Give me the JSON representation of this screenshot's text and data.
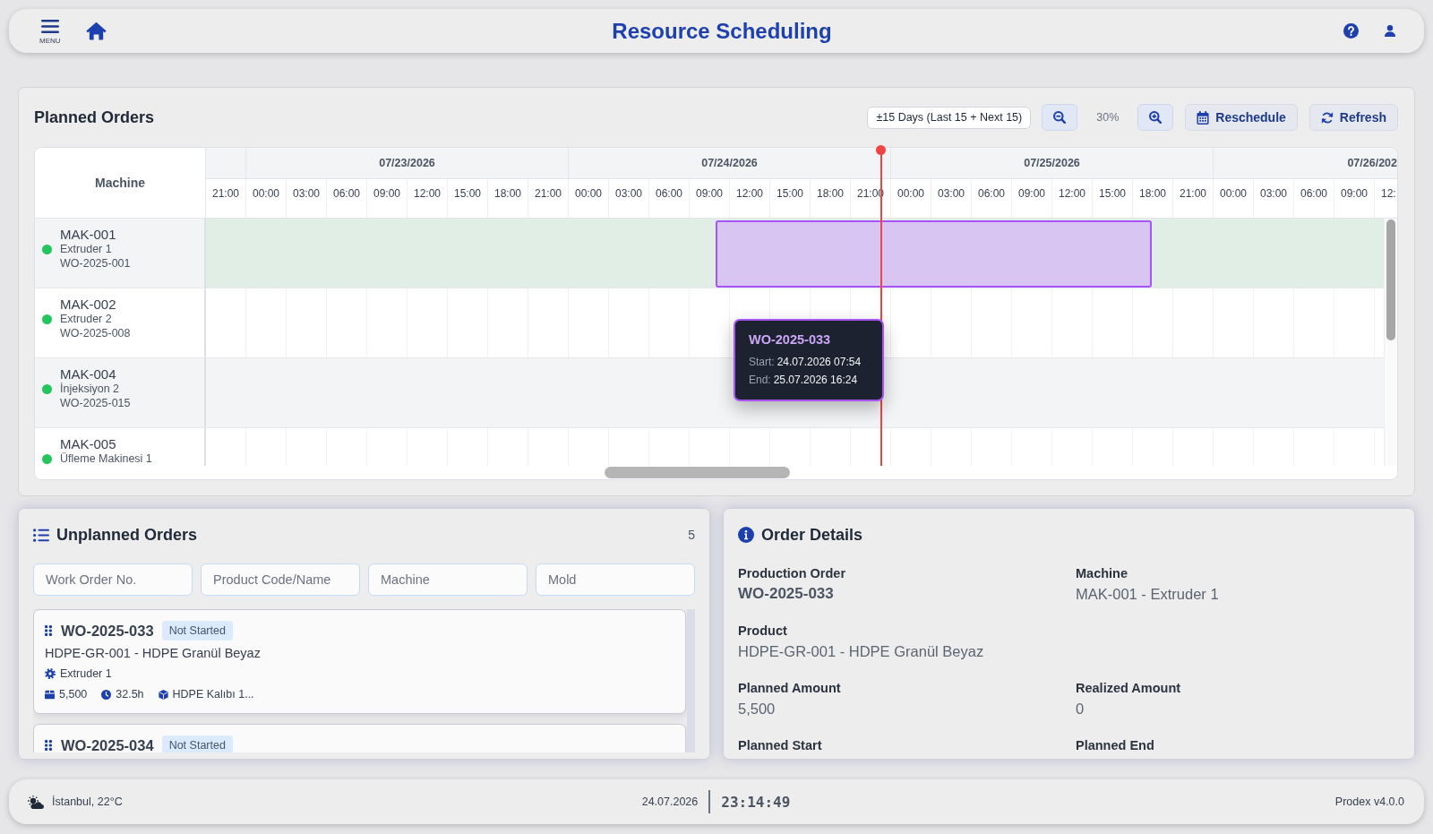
{
  "header": {
    "menu_label": "MENU",
    "title": "Resource Scheduling"
  },
  "planned_orders": {
    "title": "Planned Orders",
    "range_select": {
      "value": "±15 Days (Last 15 + Next 15)"
    },
    "zoom": {
      "reading": "30%"
    },
    "buttons": [
      {
        "label": "Reschedule",
        "kind": "calendar"
      },
      {
        "label": "Refresh",
        "kind": "refresh"
      }
    ],
    "gantt": {
      "machine_heading": "Machine",
      "lead_hours": [
        "21:00"
      ],
      "days": [
        {
          "date": "07/23/2026",
          "hours": [
            "00:00",
            "03:00",
            "06:00",
            "09:00",
            "12:00",
            "15:00",
            "18:00",
            "21:00"
          ]
        },
        {
          "date": "07/24/2026",
          "hours": [
            "00:00",
            "03:00",
            "06:00",
            "09:00",
            "12:00",
            "15:00",
            "18:00",
            "21:00"
          ]
        },
        {
          "date": "07/25/2026",
          "hours": [
            "00:00",
            "03:00",
            "06:00",
            "09:00",
            "12:00",
            "15:00",
            "18:00",
            "21:00"
          ]
        },
        {
          "date": "07/26/202",
          "hours": [
            "00:00",
            "03:00",
            "06:00",
            "09:00",
            "12:"
          ]
        }
      ],
      "rows": [
        {
          "code": "MAK-001",
          "name": "Extruder 1",
          "work_order": "WO-2025-001",
          "color": "#22c55e",
          "highlighted": true,
          "order_bar": {
            "tooltip": {
              "title": "WO-2025-033",
              "lines": [
                {
                  "label": "Start:",
                  "value": "24.07.2026 07:54"
                },
                {
                  "label": "End:",
                  "value": "25.07.2026 16:24"
                }
              ]
            }
          }
        },
        {
          "code": "MAK-002",
          "name": "Extruder 2",
          "work_order": "WO-2025-008",
          "color": "#22c55e",
          "highlighted": false
        },
        {
          "code": "MAK-004",
          "name": "İnjeksiyon 2",
          "work_order": "WO-2025-015",
          "color": "#22c55e",
          "highlighted": false
        },
        {
          "code": "MAK-005",
          "name": "Üfleme Makinesi 1",
          "color": "#22c55e",
          "highlighted": false
        }
      ]
    }
  },
  "unplanned_orders": {
    "title": "Unplanned Orders",
    "count": "5",
    "filters": [
      {
        "placeholder": "Work Order No."
      },
      {
        "placeholder": "Product Code/Name"
      },
      {
        "placeholder": "Machine"
      },
      {
        "placeholder": "Mold"
      }
    ],
    "orders": [
      {
        "number": "WO-2025-033",
        "status": "Not Started",
        "product": "HDPE-GR-001 - HDPE Granül Beyaz",
        "machine": "Extruder 1",
        "quantity": "5,500",
        "duration": "32.5h",
        "mold": "HDPE Kalıbı 1..."
      },
      {
        "number": "WO-2025-034",
        "status": "Not Started"
      }
    ]
  },
  "order_details": {
    "title": "Order Details",
    "rows": [
      {
        "fields": [
          {
            "label": "Production Order",
            "value": "WO-2025-033",
            "kind": "emphasis"
          },
          {
            "label": "Machine",
            "value": "MAK-001 - Extruder 1",
            "kind": "plain"
          }
        ]
      },
      {
        "fields": [
          {
            "label": "Product",
            "value": "HDPE-GR-001 - HDPE Granül Beyaz",
            "kind": "plain"
          }
        ]
      },
      {
        "fields": [
          {
            "label": "Planned Amount",
            "value": "5,500",
            "kind": "plain"
          },
          {
            "label": "Realized Amount",
            "value": "0",
            "kind": "plain"
          }
        ]
      },
      {
        "fields": [
          {
            "label": "Planned Start"
          },
          {
            "label": "Planned End"
          }
        ]
      }
    ]
  },
  "status_bar": {
    "weather": "İstanbul, 22°C",
    "date": "24.07.2026",
    "time": "23:14:49",
    "version": "Prodex v4.0.0"
  }
}
